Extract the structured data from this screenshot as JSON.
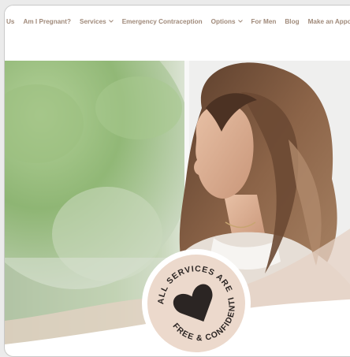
{
  "nav": {
    "items": [
      {
        "label": "Us",
        "dropdown": false
      },
      {
        "label": "Am I Pregnant?",
        "dropdown": false
      },
      {
        "label": "Services",
        "dropdown": true
      },
      {
        "label": "Emergency Contraception",
        "dropdown": false
      },
      {
        "label": "Options",
        "dropdown": true
      },
      {
        "label": "For Men",
        "dropdown": false
      },
      {
        "label": "Blog",
        "dropdown": false
      },
      {
        "label": "Make an Appoi",
        "dropdown": false
      }
    ],
    "chevron_icon": "chevron-down-icon"
  },
  "badge": {
    "top_text": "ALL SERVICES ARE",
    "bottom_text": "FREE & CONFIDENTIAL",
    "icon": "heart-icon"
  },
  "colors": {
    "nav_text": "#a08a7a",
    "badge_bg": "#ecd9cc",
    "heart": "#2b2523",
    "wave": "#ecd9cc"
  }
}
